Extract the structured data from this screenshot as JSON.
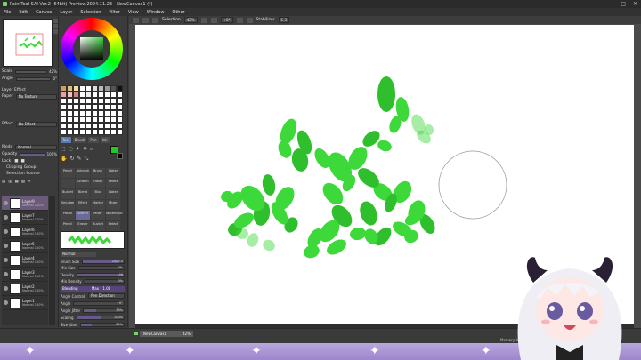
{
  "window": {
    "title": "PaintTool SAI Ver.2 (64bit) Preview.2024.11.23 - NewCanvas1 (*)",
    "controls": [
      "–",
      "□",
      "✕"
    ]
  },
  "menu": [
    "File",
    "Edit",
    "Canvas",
    "Layer",
    "Selection",
    "Filter",
    "View",
    "Window",
    "Other"
  ],
  "left": {
    "scale_label": "Scale",
    "scale_value": "42%",
    "angle_label": "Angle",
    "angle_value": "0°",
    "layer_effect_label": "Layer Effect",
    "paper_label": "Paper",
    "paper_value": "No Texture",
    "effect_label": "Effect",
    "effect_value": "No Effect",
    "mode_label": "Mode",
    "mode_value": "Normal",
    "opacity_label": "Opacity",
    "opacity_value": "100%",
    "lock_label": "Lock",
    "clipping_label": "Clipping Group",
    "selection_source_label": "Selection Source",
    "layers": [
      {
        "name": "Layer9",
        "sub": "Normal 100%"
      },
      {
        "name": "Layer7",
        "sub": "Normal 100%"
      },
      {
        "name": "Layer6",
        "sub": "Normal 100%"
      },
      {
        "name": "Layer5",
        "sub": "Normal 100%"
      },
      {
        "name": "Layer4",
        "sub": "Normal 100%"
      },
      {
        "name": "Layer3",
        "sub": "Normal 100%"
      },
      {
        "name": "Layer2",
        "sub": "Normal 100%"
      },
      {
        "name": "Layer1",
        "sub": "Normal 100%"
      }
    ]
  },
  "tools": {
    "tabs": [
      "Tool",
      "Brush",
      "Pen",
      "Ink"
    ],
    "grid": [
      "Pencil",
      "Airbrush",
      "Brush",
      "Water",
      "",
      "Scratch",
      "Eraser",
      "Select",
      "Bucket",
      "Blend",
      "Blur",
      "Water",
      "Smudge",
      "Effect",
      "Marker",
      "Mixer",
      "Pastel",
      "Sketch",
      "Mixer",
      "Watercolor",
      "Pencil",
      "Eraser",
      "Bucket",
      "Select"
    ],
    "selected_index": 17,
    "fg_color": "#22c922",
    "bg_color": "#000000"
  },
  "brush": {
    "mode": "Normal",
    "brush_size_label": "Brush Size",
    "brush_size_value": "1000.0",
    "min_size_label": "Min Size",
    "min_size_value": "0%",
    "density_label": "Density",
    "density_value": "100",
    "min_density_label": "Min Density",
    "min_density_value": "0%",
    "blending_label": "Blending",
    "max_label": "Max",
    "max_value": "1.00",
    "angle_control_label": "Angle Control",
    "angle_control_value": "Pen Direction",
    "angle_label": "Angle",
    "angle_value": "+0°",
    "angle_jitter_label": "Angle Jitter",
    "angle_jitter_value": "30%",
    "scaling_label": "Scaling",
    "scaling_value": "100%",
    "size_jitter_label": "Size Jitter",
    "size_jitter_value": "25%"
  },
  "options": {
    "selection_label": "Selection",
    "zoom_value": "42%",
    "rotation_value": "+0°",
    "stabilizer_label": "Stabilizer",
    "stabilizer_value": "S-3"
  },
  "status": {
    "doc_tab": "NewCanvas1",
    "doc_zoom": "42%",
    "memory": "Memory U"
  },
  "colors": {
    "leaf": "#3dd83a",
    "leaf_dark": "#2fbf2c",
    "band_top": "#b8a6dd",
    "band_bottom": "#9d86cc"
  }
}
